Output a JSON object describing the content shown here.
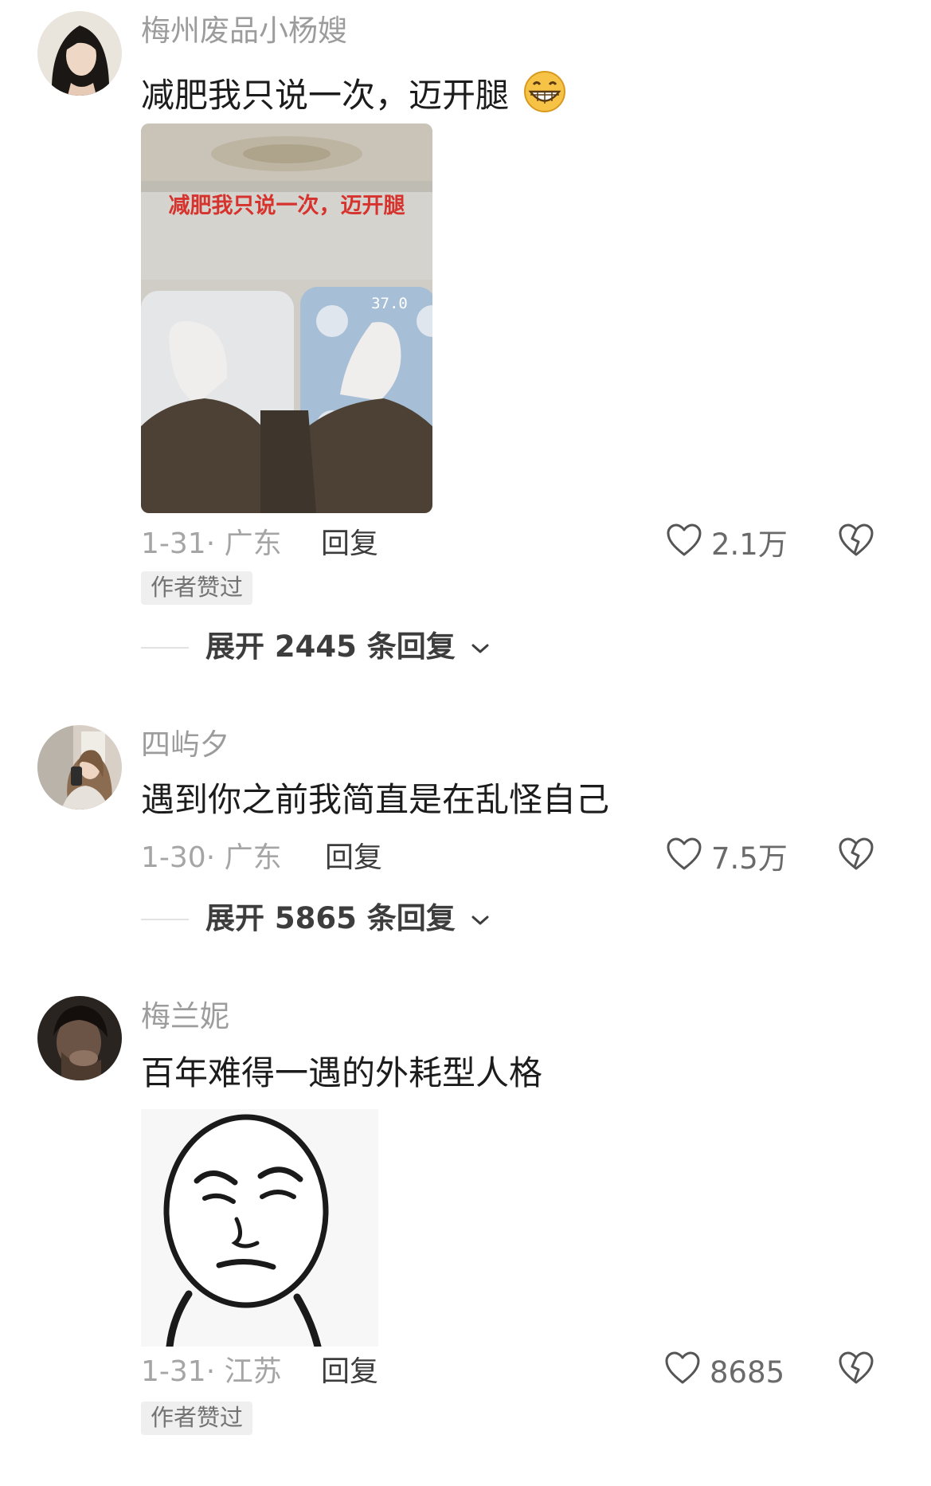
{
  "comments": [
    {
      "username": "梅州废品小杨嫂",
      "text": "减肥我只说一次，迈开腿",
      "emoji": "grinning-face-icon",
      "image": {
        "overlay_text": "减肥我只说一次，迈开腿",
        "scale_reading": "37.0"
      },
      "date_location": "1-31· 广东",
      "reply_label": "回复",
      "likes": "2.1万",
      "badge": "作者赞过",
      "expand_label": "展开 2445 条回复"
    },
    {
      "username": "四屿夕",
      "text": "遇到你之前我简直是在乱怪自己",
      "date_location": "1-30· 广东",
      "reply_label": "回复",
      "likes": "7.5万",
      "expand_label": "展开 5865 条回复"
    },
    {
      "username": "梅兰妮",
      "text": "百年难得一遇的外耗型人格",
      "image": {
        "type": "meme-face-sticker"
      },
      "date_location": "1-31· 江苏",
      "reply_label": "回复",
      "likes": "8685",
      "badge": "作者赞过"
    }
  ],
  "colors": {
    "username": "#9c9c9c",
    "text": "#1c1c1c",
    "meta": "#a5a5a5",
    "badge_bg": "#efefef"
  }
}
